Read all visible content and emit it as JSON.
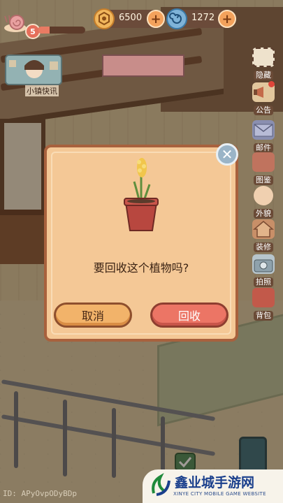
{
  "hud": {
    "level": "5",
    "xp_progress": 0.25,
    "currency_coins": "6500",
    "currency_gems": "1272"
  },
  "news": {
    "label": "小镇快讯"
  },
  "side_menu": [
    {
      "key": "hide",
      "label": "隐藏",
      "icon": "frame-icon"
    },
    {
      "key": "notice",
      "label": "公告",
      "icon": "megaphone-icon"
    },
    {
      "key": "mail",
      "label": "邮件",
      "icon": "envelope-icon"
    },
    {
      "key": "guide",
      "label": "图鉴",
      "icon": "book-icon"
    },
    {
      "key": "appearance",
      "label": "外貌",
      "icon": "face-icon"
    },
    {
      "key": "decorate",
      "label": "装修",
      "icon": "house-icon"
    },
    {
      "key": "photo",
      "label": "拍照",
      "icon": "camera-icon"
    },
    {
      "key": "bag",
      "label": "背包",
      "icon": "backpack-icon"
    }
  ],
  "dialog": {
    "question": "要回收这个植物吗?",
    "cancel_label": "取消",
    "confirm_label": "回收",
    "close_icon": "close-icon",
    "plant_icon": "potted-hyacinth-icon"
  },
  "footer": {
    "player_id": "ID: APyOvpODyBDp"
  },
  "watermark": {
    "title": "鑫业城手游网",
    "subtitle": "XINYE CITY MOBILE GAME WEBSITE"
  },
  "colors": {
    "dialog_bg": "#f4c896",
    "cancel_btn": "#f2b36a",
    "confirm_btn": "#ec7565"
  }
}
